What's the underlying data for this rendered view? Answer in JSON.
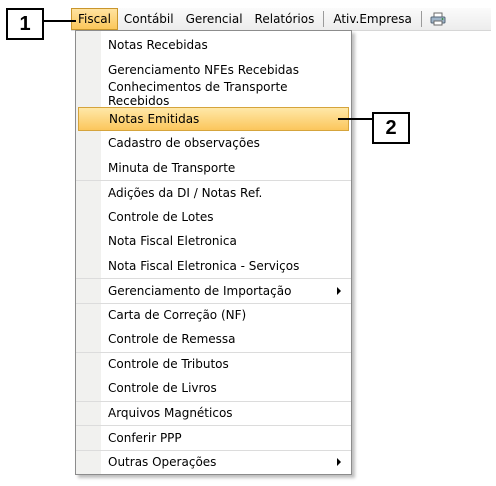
{
  "menubar": {
    "items": [
      {
        "label": "Fiscal"
      },
      {
        "label": "Contábil"
      },
      {
        "label": "Gerencial"
      },
      {
        "label": "Relatórios"
      },
      {
        "label": "Ativ.Empresa"
      }
    ],
    "print_icon": "printer-icon"
  },
  "callouts": {
    "first": "1",
    "second": "2"
  },
  "dropdown": {
    "items": [
      {
        "label": "Notas Recebidas"
      },
      {
        "label": "Gerenciamento NFEs Recebidas"
      },
      {
        "label": "Conhecimentos de Transporte Recebidos"
      },
      {
        "label": "Notas Emitidas"
      },
      {
        "label": "Cadastro de observações"
      },
      {
        "label": "Minuta de Transporte"
      },
      {
        "label": "Adições da DI / Notas Ref."
      },
      {
        "label": "Controle de Lotes"
      },
      {
        "label": "Nota Fiscal Eletronica"
      },
      {
        "label": "Nota Fiscal Eletronica - Serviços"
      },
      {
        "label": "Gerenciamento de Importação"
      },
      {
        "label": "Carta de Correção (NF)"
      },
      {
        "label": "Controle de Remessa"
      },
      {
        "label": "Controle de Tributos"
      },
      {
        "label": "Controle de Livros"
      },
      {
        "label": "Arquivos Magnéticos"
      },
      {
        "label": "Conferir PPP"
      },
      {
        "label": "Outras Operações"
      }
    ],
    "highlighted_label": "Notas Emitidas"
  },
  "colors": {
    "highlight": "#fbc65c",
    "menubar_bg": "#f4f4f4"
  }
}
